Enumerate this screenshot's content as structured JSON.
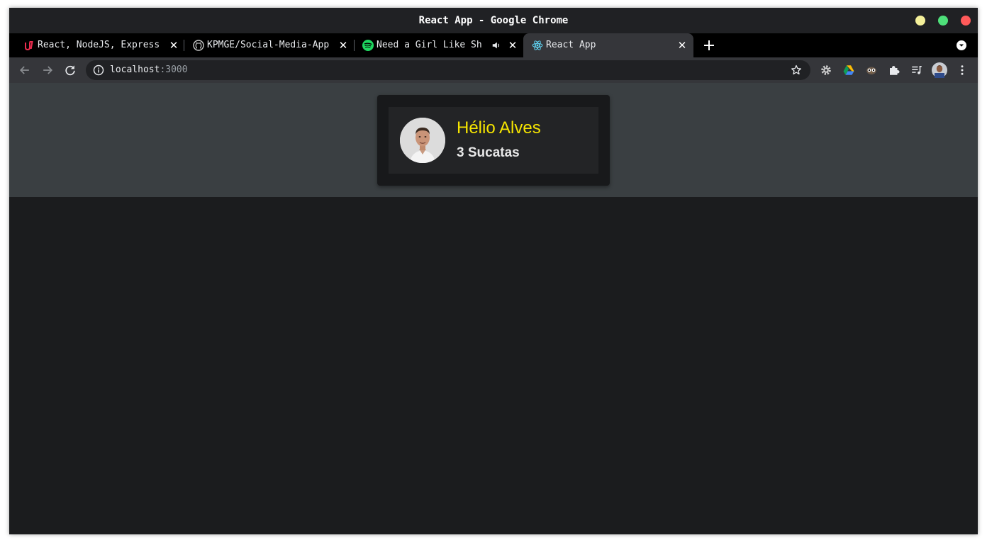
{
  "window": {
    "title": "React App - Google Chrome",
    "controls": {
      "minimize_color": "#f4f09a",
      "maximize_color": "#4ee07a",
      "close_color": "#ff5a5a"
    }
  },
  "tabs": [
    {
      "title": "React, NodeJS, Express",
      "icon": "udemy-icon",
      "active": false
    },
    {
      "title": "KPMGE/Social-Media-App",
      "icon": "github-icon",
      "active": false
    },
    {
      "title": "Need a Girl Like Sh",
      "icon": "spotify-icon",
      "audio": true,
      "active": false
    },
    {
      "title": "React App",
      "icon": "react-icon",
      "active": true
    }
  ],
  "toolbar": {
    "url_host": "localhost",
    "url_port": ":3000"
  },
  "profile_card": {
    "name": "Hélio Alves",
    "count_label": "3 Sucatas",
    "name_color": "#f5e400"
  },
  "colors": {
    "page_bg": "#1b1c1e",
    "header_bg": "#3a3f42",
    "card_bg": "#18191b",
    "card_inner_bg": "#232426"
  }
}
